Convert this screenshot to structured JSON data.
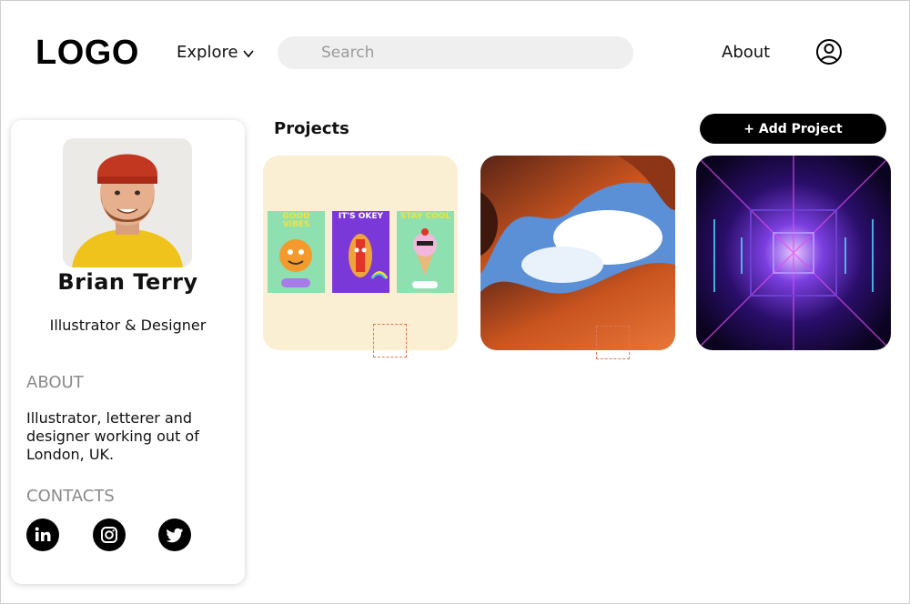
{
  "header": {
    "logo": "LOGO",
    "explore_label": "Explore",
    "search_placeholder": "Search",
    "about_label": "About"
  },
  "profile": {
    "name": "Brian Terry",
    "role": "Illustrator & Designer",
    "about_heading": "ABOUT",
    "about_text": "Illustrator, letterer and designer working out of London, UK.",
    "contacts_heading": "CONTACTS",
    "socials": [
      "linkedin-icon",
      "instagram-icon",
      "twitter-icon"
    ]
  },
  "projects": {
    "title": "Projects",
    "add_label": "+ Add Project",
    "cards": [
      {
        "kind": "poster-illustrations",
        "posters": [
          "GOOD VIBES",
          "IT'S OKEY",
          "STAY COOL"
        ]
      },
      {
        "kind": "canyon-photo"
      },
      {
        "kind": "neon-tunnel"
      }
    ]
  },
  "colors": {
    "accent": "#000000",
    "card1_bg": "#fbefd3",
    "search_bg": "#efefef"
  }
}
